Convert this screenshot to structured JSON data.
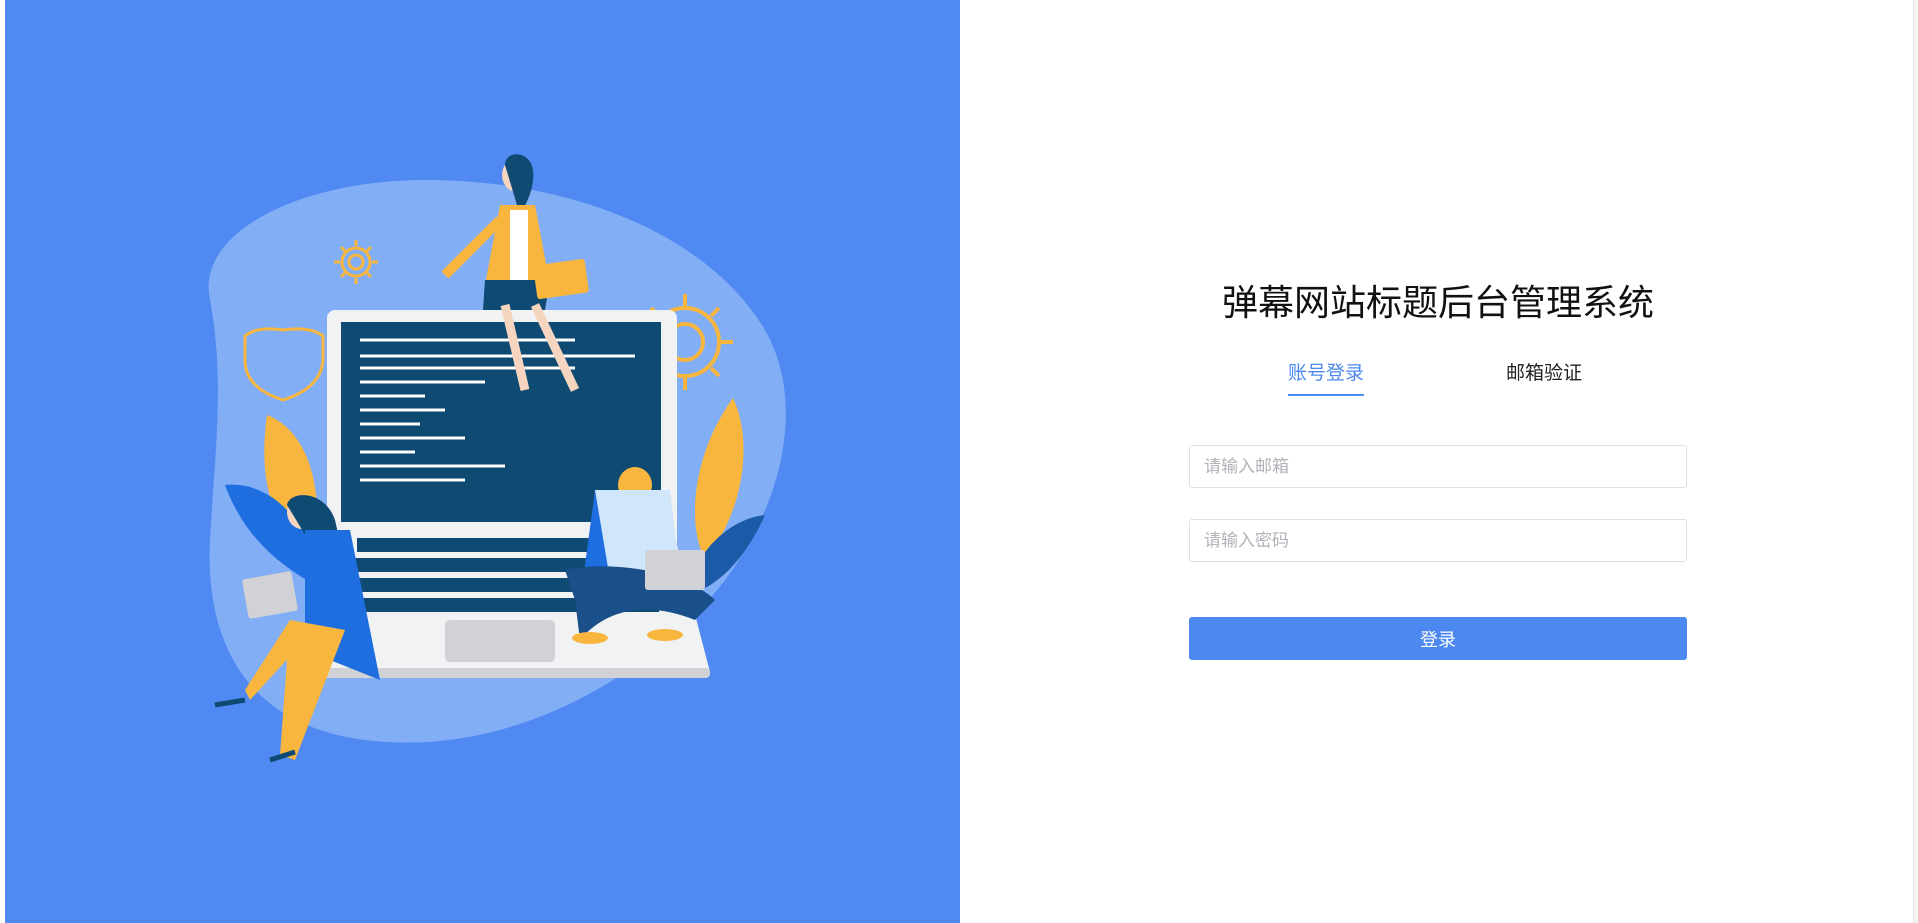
{
  "login": {
    "title": "弹幕网站标题后台管理系统",
    "tabs": [
      {
        "label": "账号登录",
        "active": true
      },
      {
        "label": "邮箱验证",
        "active": false
      }
    ],
    "email_placeholder": "请输入邮箱",
    "password_placeholder": "请输入密码",
    "submit_label": "登录"
  },
  "colors": {
    "panel_bg": "#5089f1",
    "accent": "#4b88f0",
    "illustration_blob": "#82aef6",
    "illustration_yellow": "#f8b63f",
    "illustration_navy": "#0e4a72"
  },
  "illustration": {
    "icons": [
      "gear-icon",
      "shield-icon",
      "gear-icon",
      "leaf-icon",
      "laptop-icon"
    ]
  }
}
